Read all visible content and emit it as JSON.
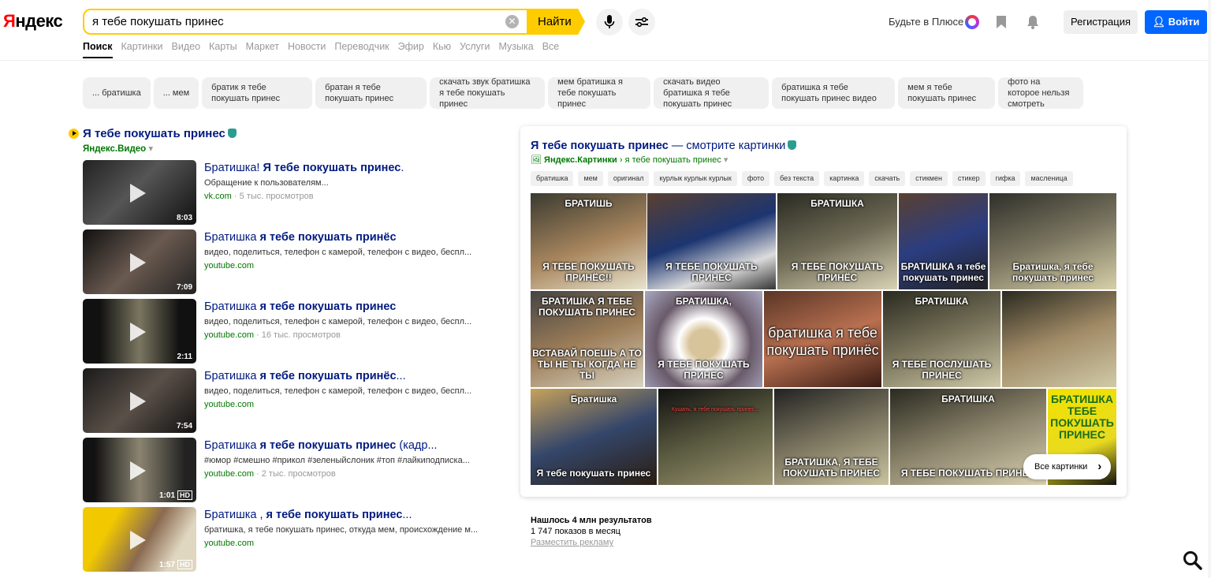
{
  "header": {
    "logo": "Яндекс",
    "search_value": "я тебе покушать принес",
    "find_label": "Найти",
    "plus_text": "Будьте в Плюсе",
    "register_label": "Регистрация",
    "login_label": "Войти",
    "tabs": [
      "Поиск",
      "Картинки",
      "Видео",
      "Карты",
      "Маркет",
      "Новости",
      "Переводчик",
      "Эфир",
      "Кью",
      "Услуги",
      "Музыка",
      "Все"
    ]
  },
  "chips": [
    "... братишка",
    "... мем",
    "братик я тебе покушать принес",
    "братан я тебе покушать принес",
    "скачать звук братишка я тебе покушать принес",
    "мем братишка я тебе покушать принес",
    "скачать видео братишка я тебе покушать принес",
    "братишка я тебе покушать принес видео",
    "мем я тебе покушать принес",
    "фото на которое нельзя смотреть"
  ],
  "video_block": {
    "title": "Я тебе покушать принес",
    "source": "Яндекс.Видео",
    "items": [
      {
        "t1": "Братишка! ",
        "t2": "Я тебе покушать принес",
        "t3": ".",
        "desc": "Обращение к пользователям...",
        "site": "vk.com",
        "views": " · 5 тыс. просмотров",
        "duration": "8:03",
        "hd": ""
      },
      {
        "t1": "Братишка ",
        "t2": "я тебе покушать принёс",
        "t3": "",
        "desc": "видео, поделиться, телефон с камерой, телефон с видео, беспл...",
        "site": "youtube.com",
        "views": "",
        "duration": "7:09",
        "hd": ""
      },
      {
        "t1": "Братишка ",
        "t2": "я тебе покушать принес",
        "t3": "",
        "desc": "видео, поделиться, телефон с камерой, телефон с видео, беспл...",
        "site": "youtube.com",
        "views": " · 16 тыс. просмотров",
        "duration": "2:11",
        "hd": ""
      },
      {
        "t1": "Братишка ",
        "t2": "я тебе покушать принёс",
        "t3": "...",
        "desc": "видео, поделиться, телефон с камерой, телефон с видео, беспл...",
        "site": "youtube.com",
        "views": "",
        "duration": "7:54",
        "hd": ""
      },
      {
        "t1": "Братишка ",
        "t2": "я тебе покушать принес",
        "t3": " (кадр...",
        "desc": "#юмор #смешно #прикол #зеленыйслоник #топ #лайкиподписка...",
        "site": "youtube.com",
        "views": " · 2 тыс. просмотров",
        "duration": "1:01",
        "hd": "HD"
      },
      {
        "t1": "Братишка , ",
        "t2": "я тебе покушать принес",
        "t3": "...",
        "desc": "братишка, я тебе покушать принес, откуда мем, происхождение м...",
        "site": "youtube.com",
        "views": "",
        "duration": "1:57",
        "hd": "HD"
      }
    ]
  },
  "images_card": {
    "title_bold": "Я тебе покушать принес",
    "title_rest": " — смотрите картинки",
    "source_bold": "Яндекс.Картинки",
    "source_rest": " › я тебе покушать принес",
    "chips": [
      "братишка",
      "мем",
      "оригинал",
      "курлык курлык курлык",
      "фото",
      "без текста",
      "картинка",
      "скачать",
      "стикмен",
      "стикер",
      "гифка",
      "масленица"
    ],
    "captions": [
      {
        "top": "БРАТИШЬ",
        "bottom": "Я ТЕБЕ ПОКУШАТЬ ПРИНЁС!!"
      },
      {
        "top": "",
        "bottom": "Я ТЕБЕ ПОКУШАТЬ ПРИНЕС"
      },
      {
        "top": "БРАТИШКА",
        "bottom": "Я ТЕБЕ ПОКУШАТЬ ПРИНЁС"
      },
      {
        "top": "",
        "bottom": "БРАТИШКА я тебе покушать принес"
      },
      {
        "top": "",
        "bottom": "Братишка, я тебе покушать принес"
      },
      {
        "top": "БРАТИШКА Я ТЕБЕ ПОКУШАТЬ ПРИНЕС",
        "bottom": "ВСТАВАЙ ПОЕШЬ А ТО ТЫ НЕ ТЫ КОГДА НЕ ТЫ"
      },
      {
        "top": "БРАТИШКА,",
        "bottom": "Я ТЕБЕ ПОКУШАТЬ ПРИНЕС"
      },
      {
        "top": "",
        "bottom": "братишка я тебе покушать принёс"
      },
      {
        "top": "БРАТИШКА",
        "bottom": "Я ТЕБЕ ПОСЛУШАТЬ ПРИНЕС"
      },
      {
        "top": "",
        "bottom": ""
      },
      {
        "top": "Братишка",
        "bottom": "Я тебе покушать принес"
      },
      {
        "top": "Кушать, я тебе покушать принес...",
        "bottom": ""
      },
      {
        "top": "",
        "bottom": "БРАТИШКА, Я ТЕБЕ ПОКУШАТЬ ПРИНЕС"
      },
      {
        "top": "БРАТИШКА",
        "bottom": "Я ТЕБЕ ПОКУШАТЬ ПРИНЕС"
      },
      {
        "top": "БРАТИШКА ТЕБЕ ПОКУШАТЬ ПРИНЕС",
        "bottom": ""
      }
    ],
    "all_label": "Все картинки"
  },
  "stats": {
    "found": "Нашлось 4 млн результатов",
    "impressions": "1 747 показов в месяц",
    "ad_link": "Разместить рекламу"
  }
}
